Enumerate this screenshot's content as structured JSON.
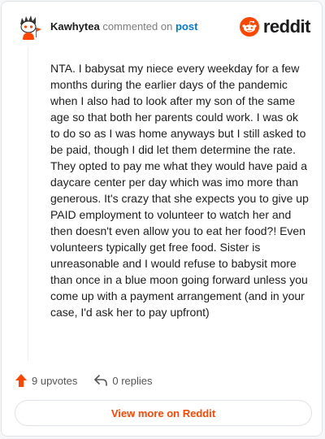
{
  "comment": {
    "author": "Kawhytea",
    "action_text": "commented on",
    "post_link_text": "post",
    "body": "NTA. I babysat my niece every weekday for a few months during the earlier days of the pandemic when I also had to look after my son of the same age so that both her parents could work. I was ok to do so as I was home anyways but I still asked to be paid, though I did let them determine the rate. They opted to pay me what they would have paid a daycare center per day which was imo more than generous. It's crazy that she expects you to give up PAID employment to volunteer to watch her and then doesn't even allow you to eat her food?! Even volunteers typically get free food. Sister is unreasonable and I would refuse to babysit more than once in a blue moon going forward unless you come up with a payment arrangement (and in your case, I'd ask her to pay upfront)",
    "upvotes_label": "9 upvotes",
    "replies_label": "0 replies"
  },
  "brand": {
    "wordmark": "reddit",
    "color": "#ff4500"
  },
  "footer": {
    "view_more_label": "View more on Reddit"
  },
  "icons": {
    "avatar": "snoo-avatar",
    "logo": "reddit-logo-icon",
    "upvote": "upvote-arrow-icon",
    "reply": "reply-arrow-icon"
  },
  "colors": {
    "link": "#0079d3",
    "upvote": "#ff4500",
    "text": "#1c1c1c",
    "muted": "#7c7c7c"
  }
}
